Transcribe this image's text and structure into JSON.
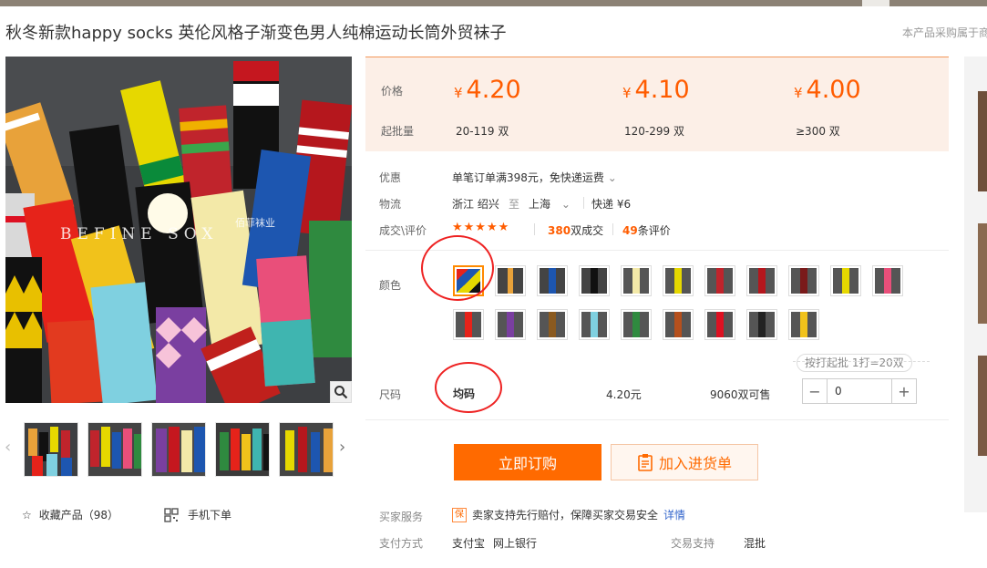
{
  "page": {
    "title": "秋冬新款happy socks 英伦风格子渐变色男人纯棉运动长筒外贸袜子",
    "right_note": "本产品采购属于商"
  },
  "gallery": {
    "watermark": "BEFINE  SOX",
    "watermark_cn": "佰菲袜业",
    "favorite_label": "收藏产品（98）",
    "mobile_label": "手机下单"
  },
  "price_box": {
    "price_label": "价格",
    "moq_label": "起批量",
    "currency": "¥",
    "tiers": [
      {
        "price": "4.20",
        "range": "20-119  双"
      },
      {
        "price": "4.10",
        "range": "120-299  双"
      },
      {
        "price": "4.00",
        "range": "≥300  双"
      }
    ]
  },
  "info": {
    "promo_label": "优惠",
    "promo_value": "单笔订单满398元，免快递运费",
    "logistics_label": "物流",
    "origin": "浙江 绍兴",
    "to": "至",
    "destination": "上海",
    "shipping": "快递 ¥6",
    "deals_label": "成交\\评价",
    "stars": "★★★★★",
    "deals_count": "380",
    "deals_suffix": "双成交",
    "reviews_count": "49",
    "reviews_suffix": "条评价"
  },
  "sku": {
    "color_label": "颜色",
    "size_label": "尺码",
    "size_value": "均码",
    "size_price": "4.20元",
    "stock": "9060双可售",
    "batch_tag": "按打起批 1打=20双",
    "quantity": "0"
  },
  "actions": {
    "buy_label": "立即订购",
    "cart_label": "加入进货单"
  },
  "services": {
    "buyer_label": "买家服务",
    "buyer_value": "卖家支持先行赔付，保障买家交易安全",
    "buyer_link": "详情",
    "pay_label": "支付方式",
    "pay_1": "支付宝",
    "pay_2": "网上银行",
    "trade_label": "交易支持",
    "trade_value": "混批"
  },
  "colors": {
    "accent": "#ff5c00",
    "button": "#ff6a00",
    "price_bg": "#fcefe7",
    "link": "#3366cc"
  }
}
